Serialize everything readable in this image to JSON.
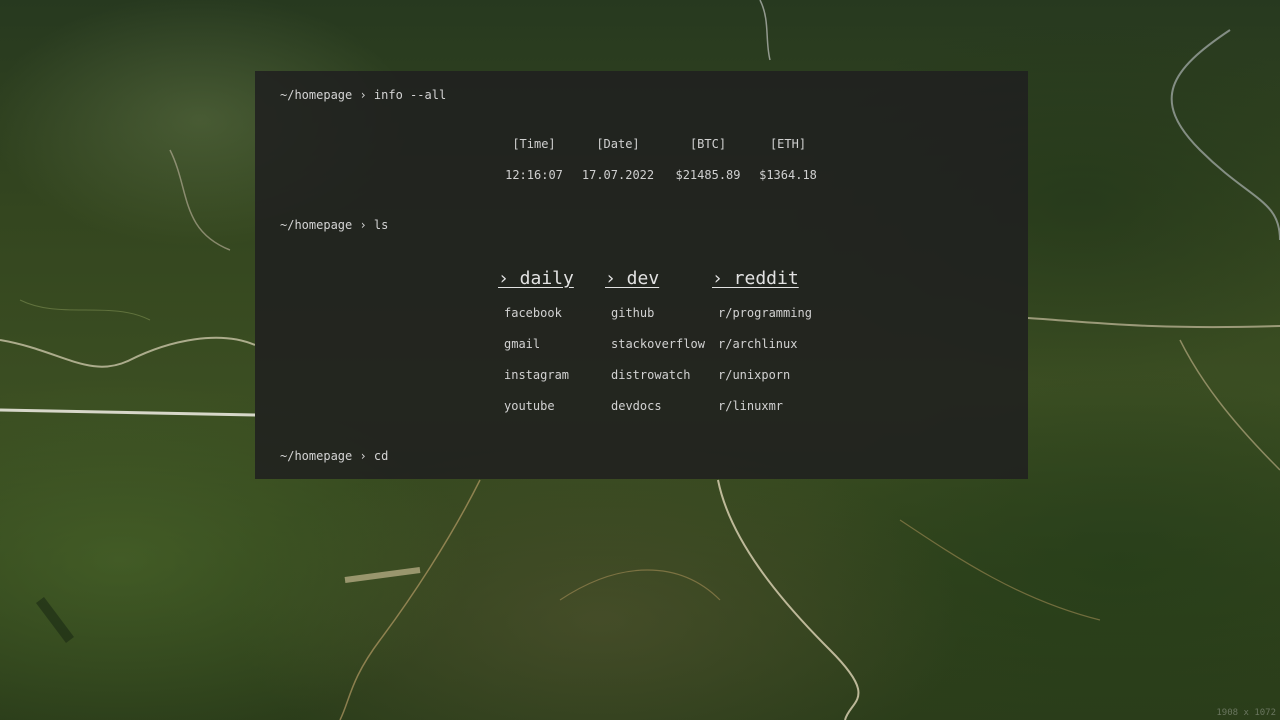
{
  "background": {
    "description_colors": [
      "#27391f",
      "#3b4e22",
      "#5f5a37"
    ]
  },
  "terminal": {
    "prompt_info": "~/homepage › info --all",
    "prompt_ls": "~/homepage › ls",
    "prompt_cd": "~/homepage › cd"
  },
  "info": {
    "headers": [
      "[Time]",
      "[Date]",
      "[BTC]",
      "[ETH]"
    ],
    "values": [
      "12:16:07",
      "17.07.2022",
      "$21485.89",
      "$1364.18"
    ]
  },
  "ls": {
    "columns": [
      {
        "title": "› daily",
        "links": [
          "facebook",
          "gmail",
          "instagram",
          "youtube"
        ]
      },
      {
        "title": "› dev",
        "links": [
          "github",
          "stackoverflow",
          "distrowatch",
          "devdocs"
        ]
      },
      {
        "title": "› reddit",
        "links": [
          "r/programming",
          "r/archlinux",
          "r/unixporn",
          "r/linuxmr"
        ]
      }
    ]
  },
  "resolution_label": "1908 x 1072"
}
